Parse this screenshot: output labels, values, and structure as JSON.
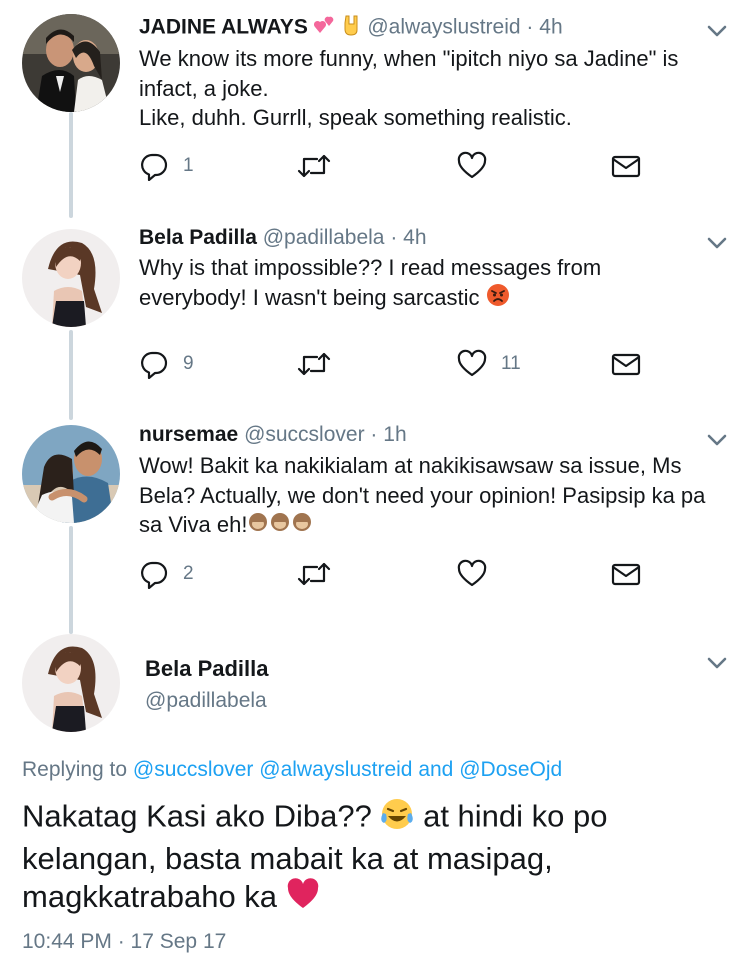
{
  "thread": [
    {
      "name": "JADINE ALWAYS",
      "handle": "@alwayslustreid",
      "time": "4h",
      "lines": [
        "We know its more funny, when \"ipitch niyo sa Jadine\" is infact, a joke.",
        "Like, duhh. Gurrll, speak something realistic."
      ],
      "replies": "1",
      "retweets": "",
      "likes": ""
    },
    {
      "name": "Bela Padilla",
      "handle": "@padillabela",
      "time": "4h",
      "lines": [
        "Why is that impossible?? I read messages from everybody! I wasn't being sarcastic"
      ],
      "replies": "9",
      "retweets": "",
      "likes": "11"
    },
    {
      "name": "nursemae",
      "handle": "@succslover",
      "time": "1h",
      "lines": [
        "Wow! Bakit ka nakikialam at nakikisawsaw sa issue, Ms Bela? Actually, we don't need your opinion! Pasipsip ka pa sa Viva eh!"
      ],
      "replies": "2",
      "retweets": "",
      "likes": ""
    }
  ],
  "main": {
    "name": "Bela Padilla",
    "handle": "@padillabela",
    "replying_prefix": "Replying to",
    "reply_1": "@succslover",
    "reply_2": "@alwayslustreid",
    "reply_and": "and",
    "reply_3": "@DoseOjd",
    "text_1": "Nakatag Kasi ako Diba??",
    "text_2": "at hindi ko po kelangan, basta mabait ka at masipag, magkkatrabaho ka",
    "timestamp": "10:44 PM · 17 Sep 17"
  },
  "icons": {
    "reply": "reply-icon",
    "retweet": "retweet-icon",
    "like": "heart-icon",
    "dm": "envelope-icon",
    "more": "chevron-down-icon"
  },
  "colors": {
    "secondary_text": "#657786",
    "link": "#1da1f2",
    "thread_line": "#ccd6dd",
    "heart_emoji": "#e0245e"
  }
}
